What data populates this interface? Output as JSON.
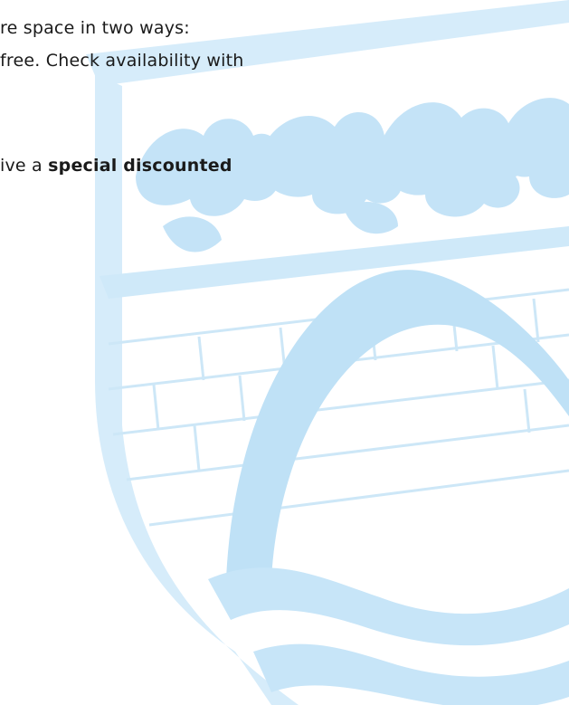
{
  "document": {
    "lines": [
      {
        "text": "re space in two ways:"
      },
      {
        "text": "free.  Check availability with"
      },
      {
        "prefix": "ive a ",
        "bold": "special discounted"
      }
    ]
  },
  "watermark": {
    "fill_color": "#c9e6f8",
    "line_color": "#b2dcf4",
    "depicts": "crest with leaves, brick wall, archway and waves"
  }
}
